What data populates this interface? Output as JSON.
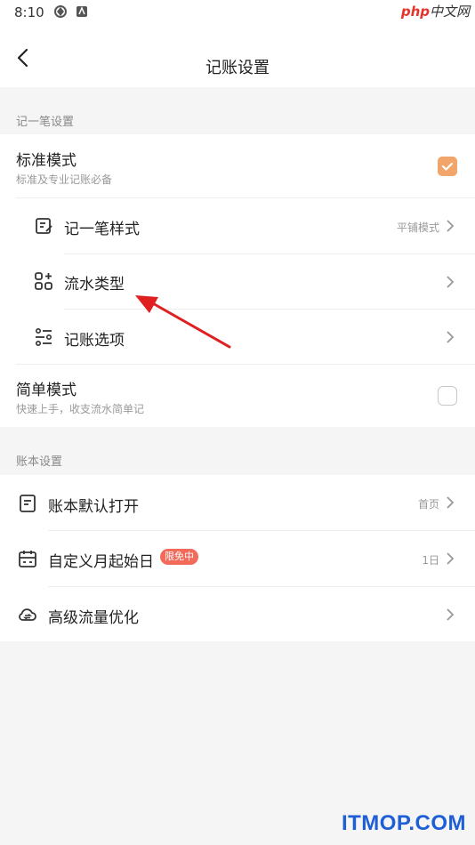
{
  "status_bar": {
    "time": "8:10"
  },
  "watermark_top": {
    "php": "php",
    "cn": "中文网"
  },
  "header": {
    "title": "记账设置"
  },
  "sections": {
    "entry": {
      "heading": "记一笔设置"
    },
    "book": {
      "heading": "账本设置"
    }
  },
  "standard_mode": {
    "label": "标准模式",
    "desc": "标准及专业记账必备",
    "checked": true
  },
  "entry_style": {
    "label": "记一笔样式",
    "value": "平铺模式"
  },
  "flow_type": {
    "label": "流水类型"
  },
  "entry_options": {
    "label": "记账选项"
  },
  "simple_mode": {
    "label": "简单模式",
    "desc": "快速上手，收支流水简单记",
    "checked": false
  },
  "default_open": {
    "label": "账本默认打开",
    "value": "首页"
  },
  "month_start": {
    "label": "自定义月起始日",
    "badge": "限免中",
    "value": "1日"
  },
  "traffic": {
    "label": "高级流量优化"
  },
  "watermark_bottom": {
    "text": "ITMOP.COM"
  },
  "colors": {
    "accent": "#f2a56a",
    "badge": "#f26a5a",
    "arrow": "#e02020"
  }
}
